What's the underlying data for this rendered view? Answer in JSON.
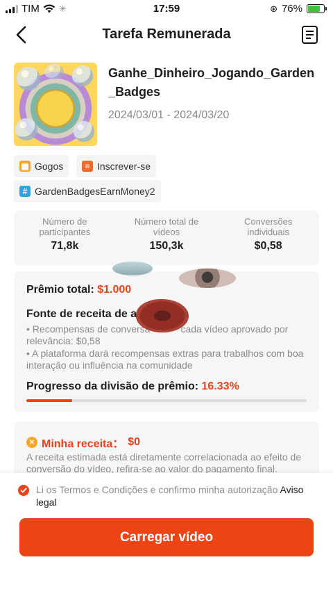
{
  "status_bar": {
    "carrier": "TIM",
    "time": "17:59",
    "battery": "76%",
    "battery_level": 0.76
  },
  "header": {
    "title": "Tarefa Remunerada"
  },
  "campaign": {
    "title": "Ganhe_Dinheiro_Jogando_Garden_Badges",
    "dates": "2024/03/01 - 2024/03/20"
  },
  "tags": [
    {
      "label": "Gogos",
      "icon": "grid-icon",
      "color": "#f5a623"
    },
    {
      "label": "Inscrever-se",
      "icon": "list-icon",
      "color": "#f06a2a"
    },
    {
      "label": "GardenBadgesEarnMoney2",
      "icon": "hash-icon",
      "color": "#2fa3e0"
    }
  ],
  "stats": [
    {
      "label": "Número de participantes",
      "value": "71,8k"
    },
    {
      "label": "Número total de vídeos",
      "value": "150,3k"
    },
    {
      "label": "Conversões individuais",
      "value": "$0,58"
    }
  ],
  "prize": {
    "total_label": "Prêmio total:",
    "total_value": "$1.000",
    "income_title": "Fonte de receita de a",
    "income_title_end": ":",
    "bullets": [
      "• Recompensas de conversã",
      "cada vídeo aprovado por relevância: $0,58",
      "• A plataforma dará recompensas extras para trabalhos com boa interação ou influência na comunidade"
    ],
    "progress_label": "Progresso da divisão de prêmio:",
    "progress_value": "16.33%",
    "progress_fraction": 0.1633
  },
  "my_income": {
    "label": "Minha receita：",
    "value": "$0",
    "description": "A receita estimada está diretamente correlacionada ao efeito de conversão do vídeo, refira-se ao valor do pagamento final."
  },
  "terms": {
    "text": "Li os Termos e Condições e confirmo minha autorização",
    "link": "Aviso legal"
  },
  "cta": {
    "label": "Carregar vídeo"
  },
  "colors": {
    "accent": "#e8431b",
    "button": "#ed4416"
  }
}
